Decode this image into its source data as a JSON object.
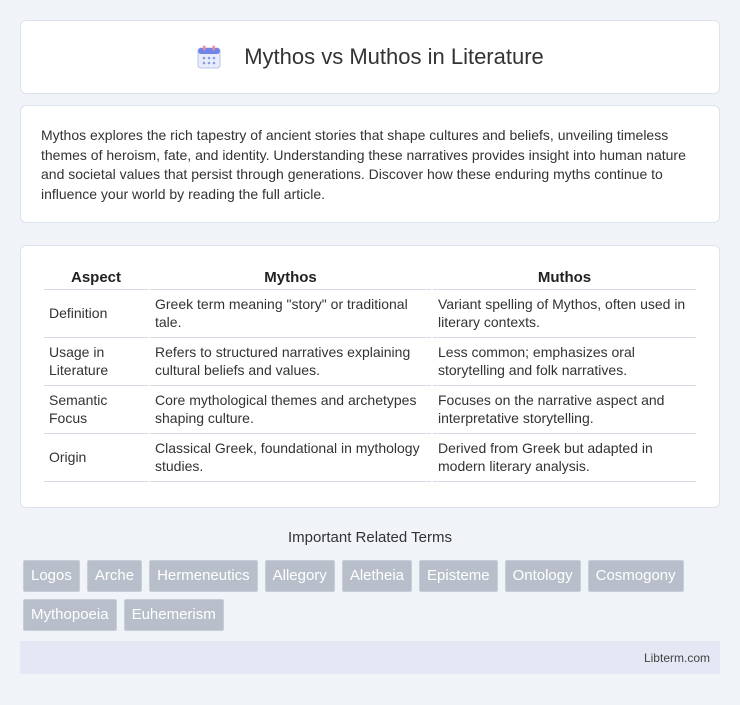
{
  "header": {
    "title": "Mythos vs Muthos in Literature",
    "icon": "calendar-icon"
  },
  "intro": {
    "text": "Mythos explores the rich tapestry of ancient stories that shape cultures and beliefs, unveiling timeless themes of heroism, fate, and identity. Understanding these narratives provides insight into human nature and societal values that persist through generations. Discover how these enduring myths continue to influence your world by reading the full article."
  },
  "table": {
    "headers": [
      "Aspect",
      "Mythos",
      "Muthos"
    ],
    "rows": [
      [
        "Definition",
        "Greek term meaning \"story\" or traditional tale.",
        "Variant spelling of Mythos, often used in literary contexts."
      ],
      [
        "Usage in Literature",
        "Refers to structured narratives explaining cultural beliefs and values.",
        "Less common; emphasizes oral storytelling and folk narratives."
      ],
      [
        "Semantic Focus",
        "Core mythological themes and archetypes shaping culture.",
        "Focuses on the narrative aspect and interpretative storytelling."
      ],
      [
        "Origin",
        "Classical Greek, foundational in mythology studies.",
        "Derived from Greek but adapted in modern literary analysis."
      ]
    ]
  },
  "related": {
    "title": "Important Related Terms",
    "tags": [
      "Logos",
      "Arche",
      "Hermeneutics",
      "Allegory",
      "Aletheia",
      "Episteme",
      "Ontology",
      "Cosmogony",
      "Mythopoeia",
      "Euhemerism"
    ]
  },
  "footer": {
    "text": "Libterm.com"
  }
}
